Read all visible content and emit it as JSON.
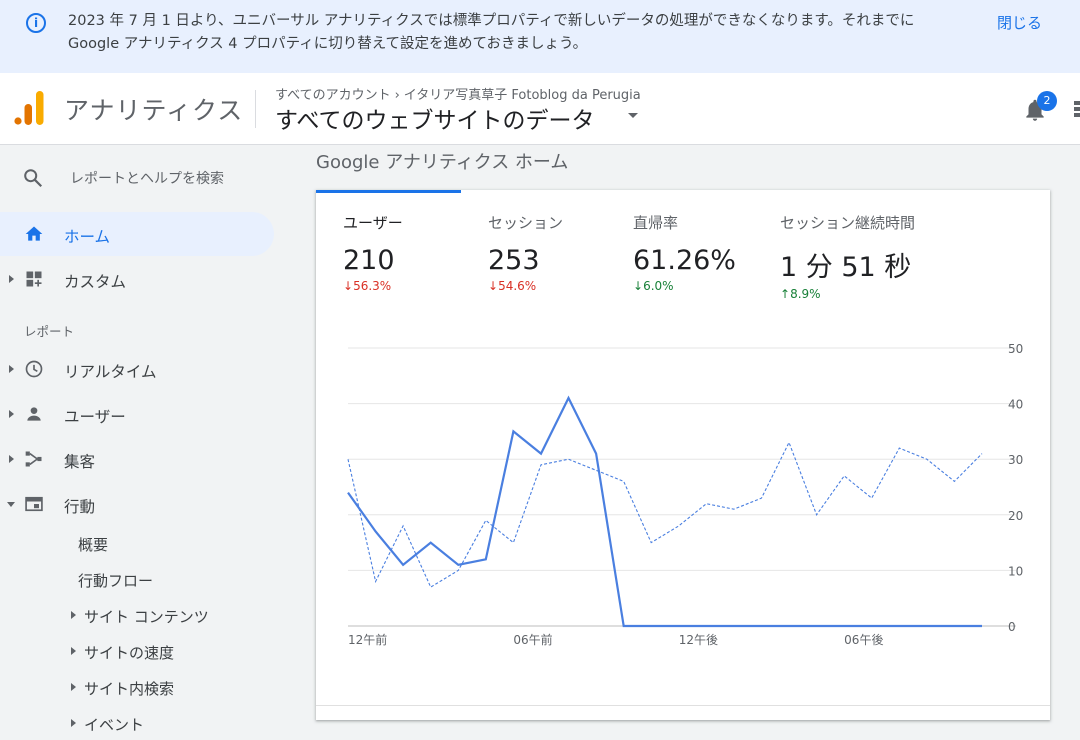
{
  "banner": {
    "text": "2023 年 7 月 1 日より、ユニバーサル アナリティクスでは標準プロパティで新しいデータの処理ができなくなります。それまでに Google アナリティクス 4 プロパティに切り替えて設定を進めておきましょう。",
    "close_label": "閉じる"
  },
  "header": {
    "app_name": "アナリティクス",
    "breadcrumb": [
      "すべてのアカウント",
      "イタリア写真草子 Fotoblog da Perugia"
    ],
    "view_name": "すべてのウェブサイトのデータ",
    "notification_count": "2"
  },
  "sidebar": {
    "search_placeholder": "レポートとヘルプを検索",
    "items": [
      {
        "label": "ホーム",
        "icon": "home-icon",
        "active": true
      },
      {
        "label": "カスタム",
        "icon": "dashboard-icon"
      }
    ],
    "section_label": "レポート",
    "report_items": [
      {
        "label": "リアルタイム",
        "icon": "clock-icon"
      },
      {
        "label": "ユーザー",
        "icon": "person-icon"
      },
      {
        "label": "集客",
        "icon": "acquisition-icon"
      },
      {
        "label": "行動",
        "icon": "behavior-icon",
        "expanded": true
      }
    ],
    "behavior_subitems": [
      {
        "label": "概要"
      },
      {
        "label": "行動フロー"
      },
      {
        "label": "サイト コンテンツ",
        "arrow": true
      },
      {
        "label": "サイトの速度",
        "arrow": true
      },
      {
        "label": "サイト内検索",
        "arrow": true
      },
      {
        "label": "イベント",
        "arrow": true
      }
    ]
  },
  "main": {
    "title": "Google アナリティクス ホーム",
    "metrics": [
      {
        "label": "ユーザー",
        "value": "210",
        "change": "56.3%",
        "direction": "down"
      },
      {
        "label": "セッション",
        "value": "253",
        "change": "54.6%",
        "direction": "down"
      },
      {
        "label": "直帰率",
        "value": "61.26%",
        "change": "6.0%",
        "direction": "down"
      },
      {
        "label": "セッション継続時間",
        "value": "1 分 51 秒",
        "change": "8.9%",
        "direction": "up"
      }
    ]
  },
  "chart_data": {
    "type": "line",
    "ylim": [
      0,
      50
    ],
    "yticks": [
      0,
      10,
      20,
      30,
      40,
      50
    ],
    "xticks": [
      "12午前",
      "06午前",
      "12午後",
      "06午後"
    ],
    "x_hours": [
      0,
      1,
      2,
      3,
      4,
      5,
      6,
      7,
      8,
      9,
      10,
      11,
      12,
      13,
      14,
      15,
      16,
      17,
      18,
      19,
      20,
      21,
      22,
      23
    ],
    "series": [
      {
        "style": "solid",
        "color": "#4a7fe0",
        "values": [
          24,
          17,
          11,
          15,
          11,
          12,
          35,
          31,
          41,
          31,
          0,
          0,
          0,
          0,
          0,
          0,
          0,
          0,
          0,
          0,
          0,
          0,
          0,
          0
        ]
      },
      {
        "style": "dashed",
        "color": "#4a7fe0",
        "values": [
          30,
          8,
          18,
          7,
          10,
          19,
          15,
          29,
          30,
          28,
          26,
          15,
          18,
          22,
          21,
          23,
          33,
          20,
          27,
          23,
          32,
          30,
          26,
          31
        ]
      }
    ]
  }
}
